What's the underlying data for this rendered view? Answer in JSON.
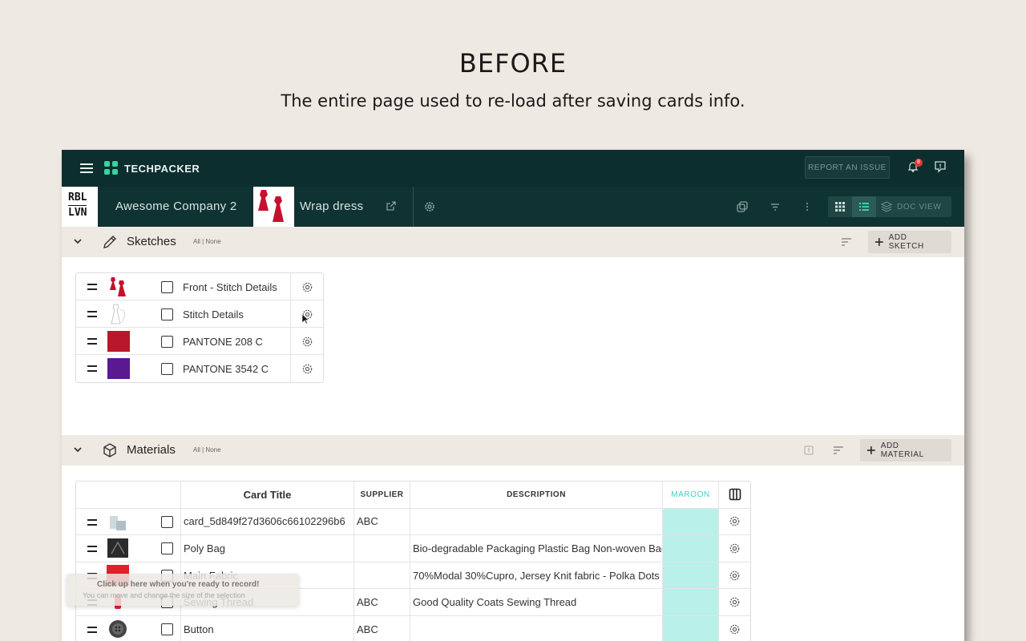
{
  "hero": {
    "title": "BEFORE",
    "subtitle": "The entire page used to re-load after saving cards info."
  },
  "topbar": {
    "app_name": "TECHPACKER",
    "report_label": "REPORT AN ISSUE",
    "notification_count": "8"
  },
  "subbar": {
    "brand_line1": "RBL",
    "brand_line2": "LVN",
    "company": "Awesome Company 2",
    "product": "Wrap dress",
    "doc_view_label": "DOC VIEW"
  },
  "sketches": {
    "title": "Sketches",
    "filter": "All | None",
    "add_label": "ADD SKETCH",
    "items": [
      {
        "label": "Front - Stitch Details",
        "thumb": "dress-red"
      },
      {
        "label": "Stitch Details",
        "thumb": "dress-outline"
      },
      {
        "label": "PANTONE 208 C",
        "thumb": "swatch",
        "color": "#b8192a"
      },
      {
        "label": "PANTONE 3542 C",
        "thumb": "swatch",
        "color": "#5a1891"
      }
    ]
  },
  "materials": {
    "title": "Materials",
    "filter": "All | None",
    "add_label": "ADD MATERIAL",
    "columns": [
      "Card Title",
      "SUPPLIER",
      "DESCRIPTION",
      "MAROON"
    ],
    "rows": [
      {
        "title": "card_5d849f27d3606c66102296b6",
        "supplier": "ABC",
        "description": ""
      },
      {
        "title": "Poly Bag",
        "supplier": "",
        "description": "Bio-degradable Packaging Plastic Bag Non-woven Bag"
      },
      {
        "title": "Main Fabric",
        "supplier": "",
        "description": "70%Modal 30%Cupro, Jersey Knit fabric - Polka Dots"
      },
      {
        "title": "Sewing Thread",
        "supplier": "ABC",
        "description": "Good Quality Coats Sewing Thread"
      },
      {
        "title": "Button",
        "supplier": "ABC",
        "description": ""
      }
    ]
  },
  "tooltip": {
    "title": "Click up here when you're ready to record!",
    "subtitle": "You can move and change the size of the selection"
  },
  "colors": {
    "topbar": "#0d2e2e",
    "accent": "#3ad2a4",
    "maroon_column": "#b9f1ea",
    "section_bg": "#efe9e3"
  }
}
